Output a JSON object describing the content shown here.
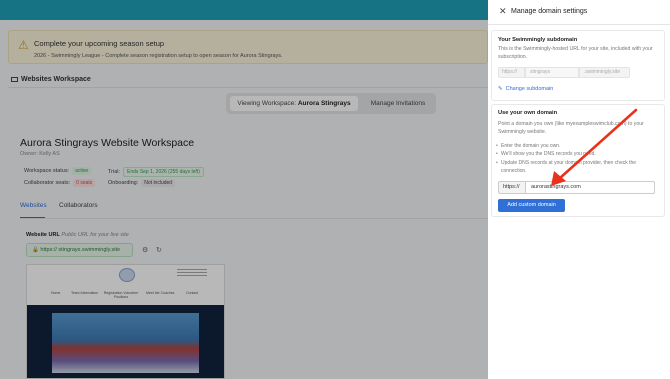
{
  "alert": {
    "title": "Complete your upcoming season setup",
    "subtitle": "2026 - Swimmingly League - Complete season registration setup to open season for Aurora Stingrays."
  },
  "workspace": {
    "heading": "Websites Workspace",
    "viewing_prefix": "Viewing Workspace:",
    "viewing_name": "Aurora Stingrays",
    "manage_invitations": "Manage Invitations",
    "title": "Aurora Stingrays Website Workspace",
    "owner": "Owner: Kelly AS",
    "status_label": "Workspace status:",
    "status_value": "active",
    "trial_label": "Trial:",
    "trial_value": "Ends Sep 1, 2026 (255 days left)",
    "seats_label": "Collaborator seats:",
    "seats_value": "0 seats",
    "onboarding_label": "Onboarding:",
    "onboarding_value": "Not included",
    "tabs": [
      "Websites",
      "Collaborators"
    ],
    "url_label": "Website URL",
    "url_hint": "Public URL for your live site",
    "url_value": "https://  stingrays.swimmingly.site"
  },
  "preview_nav": [
    "Home",
    "Team Information",
    "Registration Volunteer Positions",
    "Meet the Coaches",
    "Contact"
  ],
  "drawer": {
    "title": "Manage domain settings",
    "subdomain_heading": "Your Swimmingly subdomain",
    "subdomain_desc": "This is the Swimmingly-hosted URL for your site, included with your subscription.",
    "sub_prefix": "https://",
    "sub_value": "stingrays",
    "sub_suffix": ".swimmingly.site",
    "change_link": "Change subdomain",
    "own_heading": "Use your own domain",
    "own_desc": "Point a domain you own (like myexampleswimclub.com) to your Swimmingly website.",
    "bullets": [
      "Enter the domain you own.",
      "We'll show you the DNS records you need.",
      "Update DNS records at your domain provider, then check the connection."
    ],
    "domain_prefix": "https://",
    "domain_value": "aurorastingrays.com",
    "add_button": "Add custom domain"
  },
  "colors": {
    "topbar": "#1ea0b8",
    "primary": "#2f6fd6",
    "arrow": "#e8321e"
  }
}
